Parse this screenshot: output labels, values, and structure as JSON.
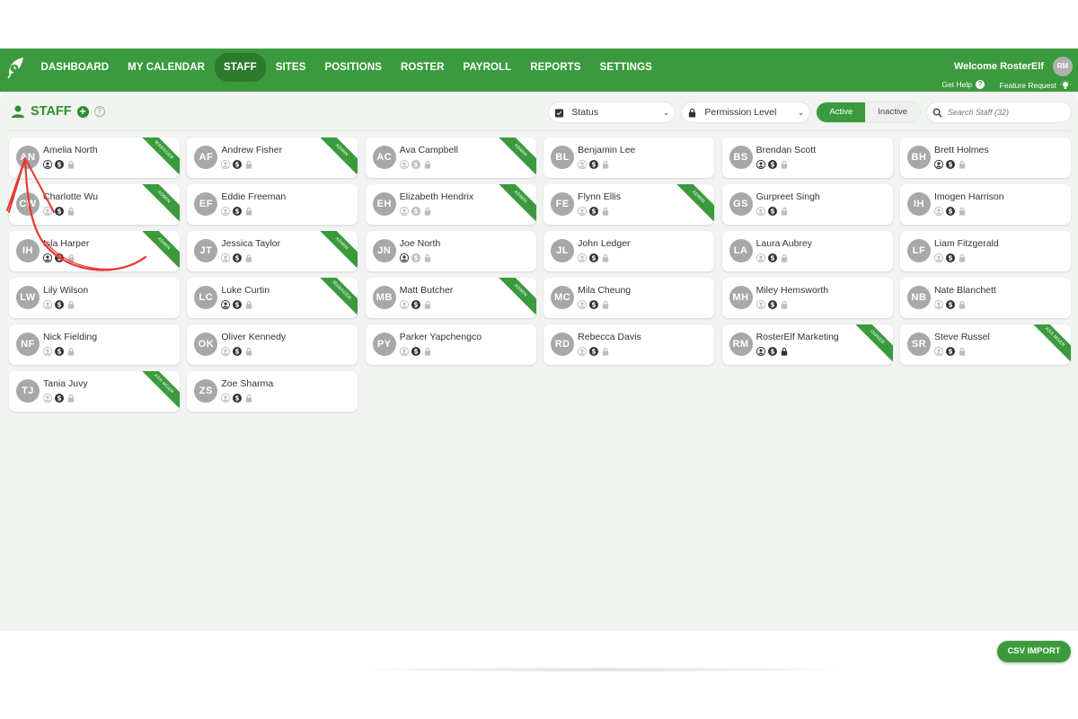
{
  "nav": {
    "items": [
      "DASHBOARD",
      "MY CALENDAR",
      "STAFF",
      "SITES",
      "POSITIONS",
      "ROSTER",
      "PAYROLL",
      "REPORTS",
      "SETTINGS"
    ],
    "welcome": "Welcome RosterElf",
    "user_initials": "RM",
    "get_help": "Get Help",
    "feature_request": "Feature Request"
  },
  "page": {
    "title": "STAFF",
    "status_select": "Status",
    "permission_select": "Permission Level",
    "toggle_active": "Active",
    "toggle_inactive": "Inactive",
    "search_placeholder": "Search Staff (32)",
    "csv_import": "CSV IMPORT"
  },
  "colors": {
    "brand": "#3b9a3d",
    "brand_dark": "#2c7a2e",
    "avatar": "#a8a8a8"
  },
  "staff": [
    {
      "initials": "AN",
      "name": "Amelia North",
      "ribbon": "MANAGER",
      "icons": [
        1,
        1,
        0
      ]
    },
    {
      "initials": "AF",
      "name": "Andrew Fisher",
      "ribbon": "ADMIN",
      "icons": [
        0,
        1,
        0
      ]
    },
    {
      "initials": "AC",
      "name": "Ava Campbell",
      "ribbon": "ADMIN",
      "icons": [
        0,
        0,
        0
      ]
    },
    {
      "initials": "BL",
      "name": "Benjamin Lee",
      "ribbon": "",
      "icons": [
        0,
        1,
        0
      ]
    },
    {
      "initials": "BS",
      "name": "Brendan Scott",
      "ribbon": "",
      "icons": [
        1,
        1,
        0
      ]
    },
    {
      "initials": "BH",
      "name": "Brett Holmes",
      "ribbon": "",
      "icons": [
        1,
        1,
        0
      ]
    },
    {
      "initials": "CW",
      "name": "Charlotte Wu",
      "ribbon": "ADMIN",
      "icons": [
        0,
        1,
        0
      ]
    },
    {
      "initials": "EF",
      "name": "Eddie Freeman",
      "ribbon": "",
      "icons": [
        0,
        1,
        0
      ]
    },
    {
      "initials": "EH",
      "name": "Elizabeth Hendrix",
      "ribbon": "ADMIN",
      "icons": [
        0,
        0,
        0
      ]
    },
    {
      "initials": "FE",
      "name": "Flynn Ellis",
      "ribbon": "ADMIN",
      "icons": [
        0,
        1,
        0
      ]
    },
    {
      "initials": "GS",
      "name": "Gurpreet Singh",
      "ribbon": "",
      "icons": [
        0,
        1,
        0
      ]
    },
    {
      "initials": "IH",
      "name": "Imogen Harrison",
      "ribbon": "",
      "icons": [
        0,
        1,
        0
      ]
    },
    {
      "initials": "IH",
      "name": "Isla Harper",
      "ribbon": "ADMIN",
      "icons": [
        1,
        1,
        0
      ]
    },
    {
      "initials": "JT",
      "name": "Jessica Taylor",
      "ribbon": "ADMIN",
      "icons": [
        0,
        1,
        0
      ]
    },
    {
      "initials": "JN",
      "name": "Joe North",
      "ribbon": "",
      "icons": [
        1,
        0,
        0
      ]
    },
    {
      "initials": "JL",
      "name": "John Ledger",
      "ribbon": "",
      "icons": [
        0,
        1,
        0
      ]
    },
    {
      "initials": "LA",
      "name": "Laura Aubrey",
      "ribbon": "",
      "icons": [
        0,
        1,
        0
      ]
    },
    {
      "initials": "LF",
      "name": "Liam Fitzgerald",
      "ribbon": "",
      "icons": [
        0,
        1,
        0
      ]
    },
    {
      "initials": "LW",
      "name": "Lily Wilson",
      "ribbon": "",
      "icons": [
        0,
        1,
        0
      ]
    },
    {
      "initials": "LC",
      "name": "Luke Curtin",
      "ribbon": "MANAGER",
      "icons": [
        1,
        1,
        0
      ]
    },
    {
      "initials": "MB",
      "name": "Matt Butcher",
      "ribbon": "ADMIN",
      "icons": [
        0,
        1,
        0
      ]
    },
    {
      "initials": "MC",
      "name": "Mila Cheung",
      "ribbon": "",
      "icons": [
        0,
        1,
        0
      ]
    },
    {
      "initials": "MH",
      "name": "Miley Hemsworth",
      "ribbon": "",
      "icons": [
        0,
        1,
        0
      ]
    },
    {
      "initials": "NB",
      "name": "Nate Blanchett",
      "ribbon": "",
      "icons": [
        0,
        1,
        0
      ]
    },
    {
      "initials": "NF",
      "name": "Nick Fielding",
      "ribbon": "",
      "icons": [
        0,
        1,
        0
      ]
    },
    {
      "initials": "OK",
      "name": "Oliver Kennedy",
      "ribbon": "",
      "icons": [
        0,
        1,
        0
      ]
    },
    {
      "initials": "PY",
      "name": "Parker Yapchengco",
      "ribbon": "",
      "icons": [
        0,
        1,
        0
      ]
    },
    {
      "initials": "RD",
      "name": "Rebecca Davis",
      "ribbon": "",
      "icons": [
        0,
        1,
        0
      ]
    },
    {
      "initials": "RM",
      "name": "RosterElf Marketing",
      "ribbon": "OWNER",
      "icons": [
        1,
        1,
        1
      ]
    },
    {
      "initials": "SR",
      "name": "Steve Russel",
      "ribbon": "ASS MGER",
      "icons": [
        0,
        1,
        0
      ]
    },
    {
      "initials": "TJ",
      "name": "Tania Juvy",
      "ribbon": "ASS MGER",
      "icons": [
        0,
        1,
        0
      ]
    },
    {
      "initials": "ZS",
      "name": "Zoe Sharma",
      "ribbon": "",
      "icons": [
        0,
        1,
        0
      ]
    }
  ]
}
